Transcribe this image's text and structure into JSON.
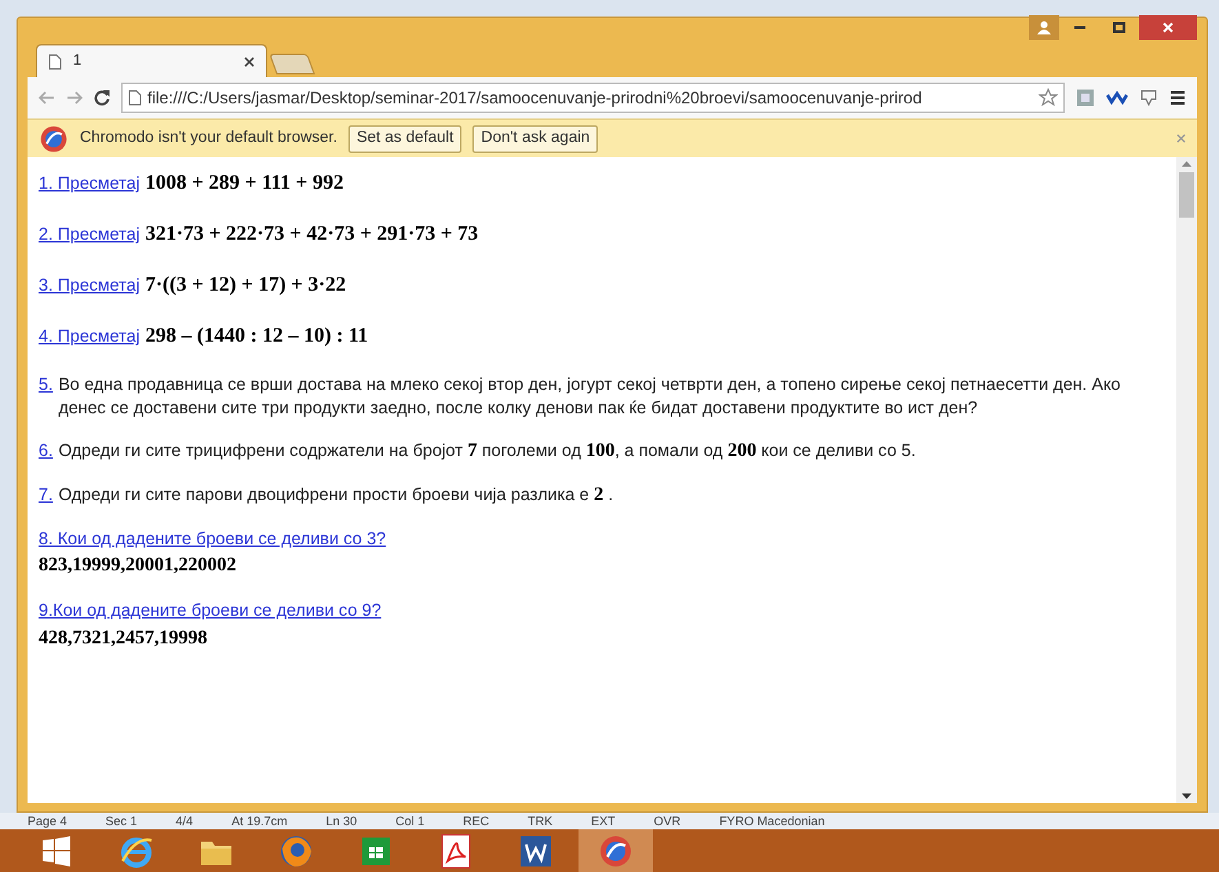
{
  "tabs": [
    {
      "title": "1",
      "selected": true
    }
  ],
  "address": "file:///C:/Users/jasmar/Desktop/seminar-2017/samoocenuvanje-prirodni%20broevi/samoocenuvanje-prirod",
  "infobar": {
    "message": "Chromodo isn't your default browser.",
    "buttons": [
      "Set as default",
      "Don't ask again"
    ]
  },
  "problems": [
    {
      "kind": "expression",
      "link": "1. Пресметај",
      "math": "1008 + 289 + 111 + 992"
    },
    {
      "kind": "expression",
      "link": "2. Пресметај",
      "math": "321·73 + 222·73 + 42·73 + 291·73 + 73"
    },
    {
      "kind": "expression",
      "link": "3. Пресметај",
      "math": "7·((3 + 12) + 17) + 3·22"
    },
    {
      "kind": "expression",
      "link": "4. Пресметај",
      "math": "298 – (1440 : 12 – 10) : 11"
    },
    {
      "kind": "text",
      "link": "5.",
      "text": "Во една продавница се врши достава на млеко секој втор ден, јогурт секој четврти ден, а топено сирење секој петнаесетти ден. Ако денес се доставени сите три продукти заедно, после колку денови пак ќе бидат доставени продуктите во ист ден?"
    },
    {
      "kind": "text",
      "link": "6.",
      "text": "Одреди ги сите трицифрени содржатели на бројот **7** поголеми од **100**, а помали од **200** кои се деливи со 5."
    },
    {
      "kind": "text",
      "link": "7.",
      "text": "Одреди ги сите парови двоцифрени прости броеви чија разлика е **2** ."
    },
    {
      "kind": "list",
      "link": "8. Кои од дадените броеви се деливи со 3?",
      "numbers": "823,19999,20001,220002"
    },
    {
      "kind": "list",
      "link": "9.Кои од дадените броеви се деливи со 9?",
      "numbers": "428,7321,2457,19998"
    }
  ],
  "word_status": [
    "Page 4",
    "Sec 1",
    "4/4",
    "At 19.7cm",
    "Ln 30",
    "Col 1",
    "REC",
    "TRK",
    "EXT",
    "OVR",
    "FYRO Macedonian"
  ],
  "taskbar": [
    {
      "kind": "start",
      "selected": false
    },
    {
      "kind": "ie",
      "selected": false
    },
    {
      "kind": "folder",
      "selected": false
    },
    {
      "kind": "firefox",
      "selected": false
    },
    {
      "kind": "store",
      "selected": false
    },
    {
      "kind": "pdf",
      "selected": false
    },
    {
      "kind": "word",
      "selected": false
    },
    {
      "kind": "chromodo",
      "selected": true
    }
  ]
}
